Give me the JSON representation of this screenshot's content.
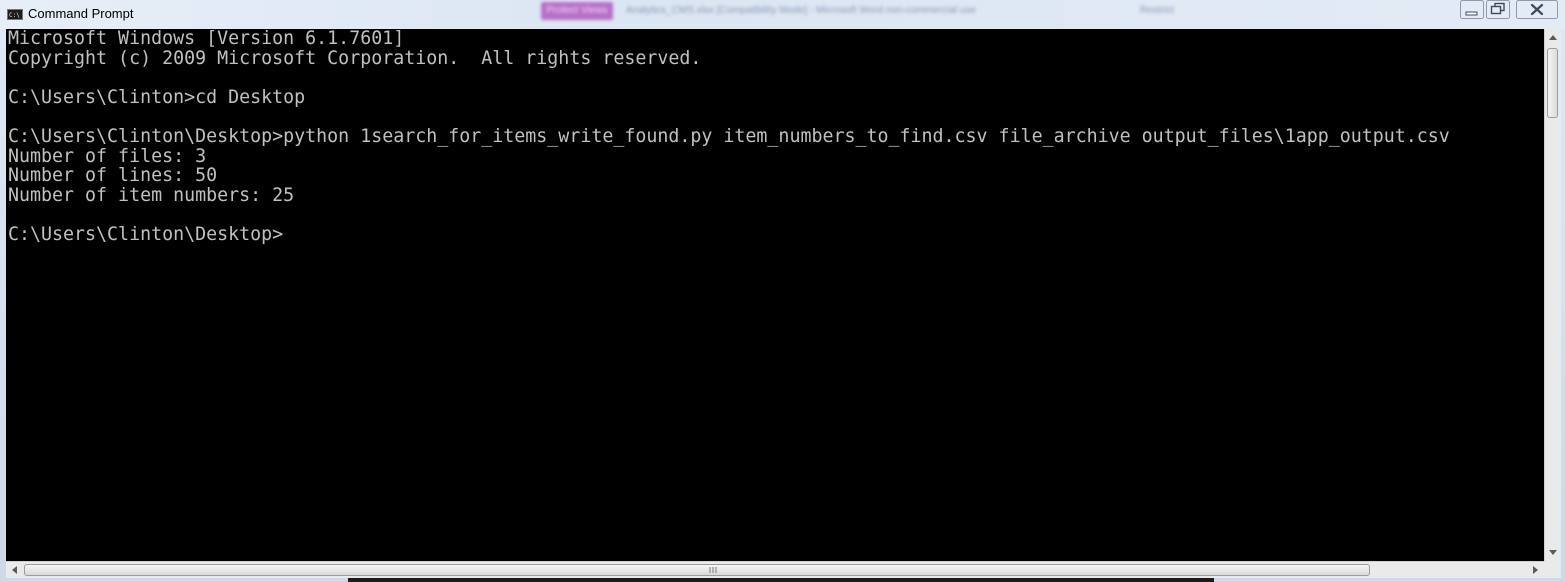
{
  "window": {
    "title": "Command Prompt",
    "icon": "console-icon",
    "controls": {
      "minimize_icon": "minimize-icon",
      "maximize_icon": "restore-icon",
      "close_icon": "close-icon"
    }
  },
  "background_window_fragments": {
    "tab_label": "Protect Views",
    "title": "Analytics_CMS.xlsx [Compatibility Mode] - Microsoft Word non-commercial use",
    "extra": "Restrict"
  },
  "console": {
    "lines": [
      "Microsoft Windows [Version 6.1.7601]",
      "Copyright (c) 2009 Microsoft Corporation.  All rights reserved.",
      "",
      "C:\\Users\\Clinton>cd Desktop",
      "",
      "C:\\Users\\Clinton\\Desktop>python 1search_for_items_write_found.py item_numbers_to_find.csv file_archive output_files\\1app_output.csv",
      "Number of files: 3",
      "Number of lines: 50",
      "Number of item numbers: 25",
      "",
      "C:\\Users\\Clinton\\Desktop>"
    ],
    "text_color": "#c0c0c0",
    "background_color": "#000000"
  },
  "scrollbars": {
    "vertical": {
      "position_fraction": 0.0
    },
    "horizontal": {
      "position_fraction": 0.0
    }
  }
}
